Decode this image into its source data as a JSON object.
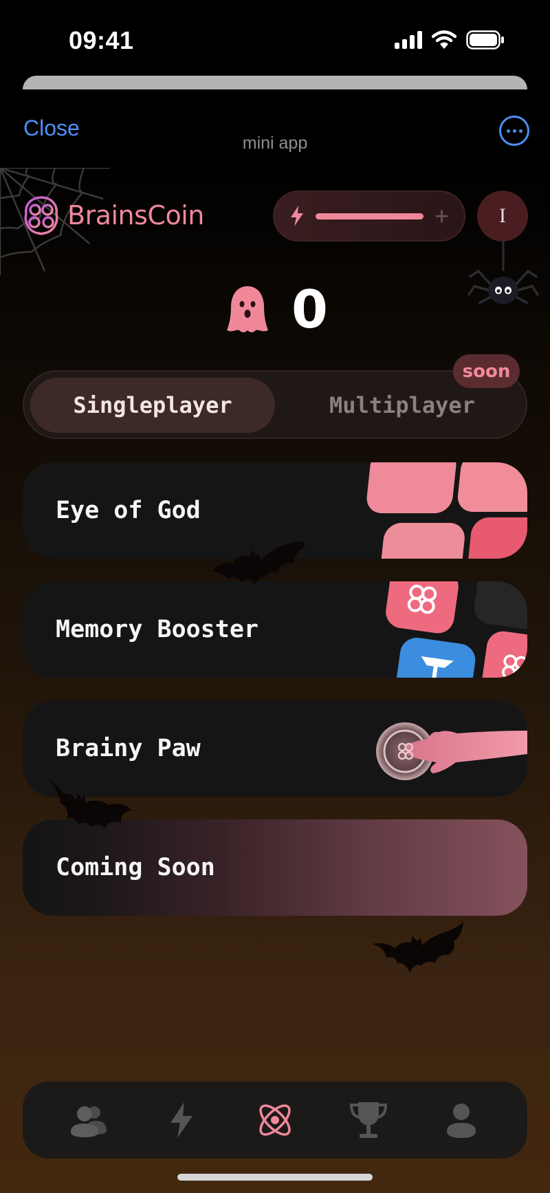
{
  "status_bar": {
    "time": "09:41"
  },
  "header": {
    "close_label": "Close",
    "title": "mini app",
    "more_icon": "ellipsis-circle-icon"
  },
  "brand": {
    "name": "BrainsCoin",
    "logo_icon": "brain-logo-icon"
  },
  "energy": {
    "level": 1.0,
    "add_label": "+"
  },
  "avatar": {
    "initial": "I"
  },
  "score": {
    "icon": "ghost-icon",
    "value": "0"
  },
  "modes": {
    "tabs": [
      {
        "label": "Singleplayer",
        "active": true
      },
      {
        "label": "Multiplayer",
        "active": false
      }
    ],
    "badge": "soon"
  },
  "games": [
    {
      "label": "Eye of God"
    },
    {
      "label": "Memory Booster"
    },
    {
      "label": "Brainy Paw"
    },
    {
      "label": "Coming Soon"
    }
  ],
  "bottom_nav": [
    {
      "icon": "friends-icon",
      "active": false
    },
    {
      "icon": "lightning-icon",
      "active": false
    },
    {
      "icon": "atom-icon",
      "active": true
    },
    {
      "icon": "trophy-icon",
      "active": false
    },
    {
      "icon": "profile-icon",
      "active": false
    }
  ],
  "colors": {
    "accent": "#f0889a",
    "link": "#4f8ef7",
    "card": "#151515",
    "background_bottom": "#43280f"
  }
}
